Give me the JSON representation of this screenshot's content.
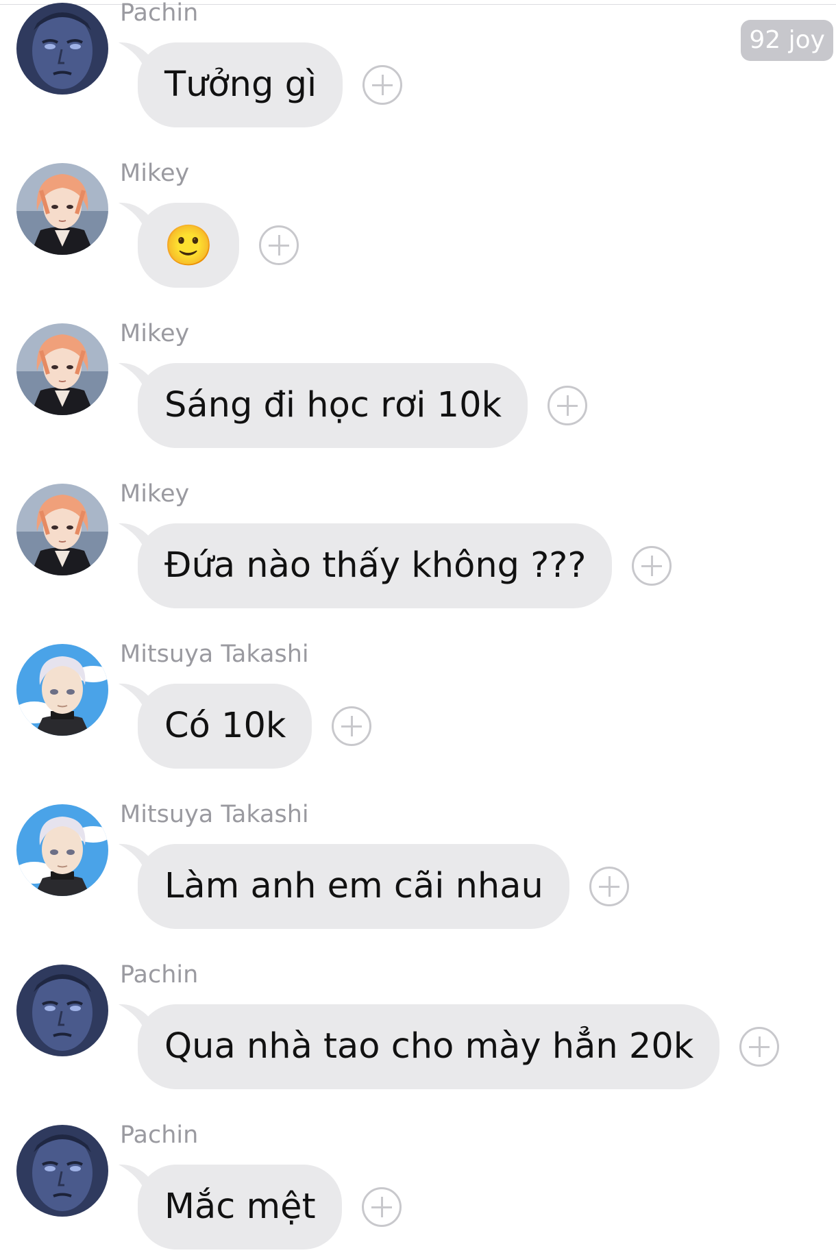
{
  "header": {
    "badge_text": "92 joy"
  },
  "messages": [
    {
      "sender": "Pachin",
      "text": "Tưởng gì",
      "avatar": "pachin"
    },
    {
      "sender": "Mikey",
      "text": "🙂",
      "avatar": "mikey"
    },
    {
      "sender": "Mikey",
      "text": "Sáng đi học rơi 10k",
      "avatar": "mikey"
    },
    {
      "sender": "Mikey",
      "text": "Đứa nào thấy không ???",
      "avatar": "mikey"
    },
    {
      "sender": "Mitsuya Takashi",
      "text": "Có 10k",
      "avatar": "mitsuya"
    },
    {
      "sender": "Mitsuya Takashi",
      "text": "Làm anh em cãi nhau",
      "avatar": "mitsuya"
    },
    {
      "sender": "Pachin",
      "text": "Qua nhà tao cho mày hẳn 20k",
      "avatar": "pachin"
    },
    {
      "sender": "Pachin",
      "text": "Mắc mệt",
      "avatar": "pachin"
    }
  ],
  "icons": {
    "reaction": "add-reaction-icon",
    "avatar": "user-avatar"
  },
  "colors": {
    "bubble": "#e9e9eb",
    "sender": "#9a9aa0",
    "badge": "#c7c7cc",
    "react": "#c8c8cc"
  }
}
